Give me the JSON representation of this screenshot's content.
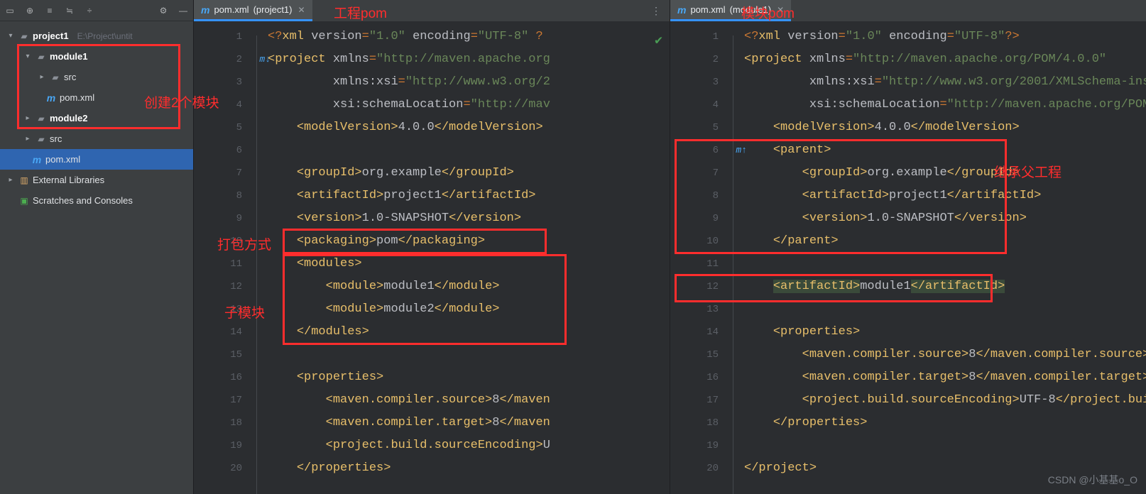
{
  "toolbar": {
    "icons": [
      "display-icon",
      "select-icon",
      "expand-icon",
      "collapse-icon",
      "divider-icon",
      "gear-icon",
      "hide-icon"
    ]
  },
  "tree": {
    "project": {
      "name": "project1",
      "path": "E:\\Project\\untit"
    },
    "module1": {
      "name": "module1"
    },
    "src1": {
      "name": "src"
    },
    "pom_m1": {
      "name": "pom.xml"
    },
    "module2": {
      "name": "module2"
    },
    "src_p": {
      "name": "src"
    },
    "pom_p": {
      "name": "pom.xml"
    },
    "ext": {
      "name": "External Libraries"
    },
    "scr": {
      "name": "Scratches and Consoles"
    }
  },
  "tabs": {
    "left": {
      "file": "pom.xml",
      "context": "(project1)"
    },
    "right": {
      "file": "pom.xml",
      "context": "(module1)"
    }
  },
  "annotations": {
    "proj_pom": "工程pom",
    "mod_pom": "模块pom",
    "create2mod": "创建2个模块",
    "packaging": "打包方式",
    "submodule": "子模块",
    "inherit": "继承父工程"
  },
  "watermark": "CSDN @小基基o_O",
  "code": {
    "left": [
      {
        "n": 1,
        "ind": 0,
        "tokens": [
          {
            "t": "op",
            "v": "<?"
          },
          {
            "t": "tag",
            "v": "xml "
          },
          {
            "t": "attr",
            "v": "version"
          },
          {
            "t": "op",
            "v": "="
          },
          {
            "t": "val",
            "v": "\"1.0\""
          },
          {
            "t": "txt",
            "v": " "
          },
          {
            "t": "attr",
            "v": "encoding"
          },
          {
            "t": "op",
            "v": "="
          },
          {
            "t": "val",
            "v": "\"UTF-8\""
          },
          {
            "t": "txt",
            "v": " "
          },
          {
            "t": "op",
            "v": "?"
          }
        ]
      },
      {
        "n": 2,
        "gmark": "m↓",
        "ind": 0,
        "tokens": [
          {
            "t": "tag",
            "v": "<project "
          },
          {
            "t": "attr",
            "v": "xmlns"
          },
          {
            "t": "op",
            "v": "="
          },
          {
            "t": "val",
            "v": "\"http://maven.apache.org"
          }
        ]
      },
      {
        "n": 3,
        "ind": 9,
        "tokens": [
          {
            "t": "attr",
            "v": "xmlns:xsi"
          },
          {
            "t": "op",
            "v": "="
          },
          {
            "t": "val",
            "v": "\"http://www.w3.org/2"
          }
        ]
      },
      {
        "n": 4,
        "ind": 9,
        "tokens": [
          {
            "t": "attr",
            "v": "xsi"
          },
          {
            "t": "txt",
            "v": ":"
          },
          {
            "t": "attr",
            "v": "schemaLocation"
          },
          {
            "t": "op",
            "v": "="
          },
          {
            "t": "val",
            "v": "\"http://mav"
          }
        ]
      },
      {
        "n": 5,
        "ind": 4,
        "tokens": [
          {
            "t": "tag",
            "v": "<modelVersion>"
          },
          {
            "t": "txt",
            "v": "4.0.0"
          },
          {
            "t": "tag",
            "v": "</modelVersion>"
          }
        ]
      },
      {
        "n": 6,
        "ind": 0,
        "tokens": []
      },
      {
        "n": 7,
        "ind": 4,
        "tokens": [
          {
            "t": "tag",
            "v": "<groupId>"
          },
          {
            "t": "txt",
            "v": "org.example"
          },
          {
            "t": "tag",
            "v": "</groupId>"
          }
        ]
      },
      {
        "n": 8,
        "ind": 4,
        "tokens": [
          {
            "t": "tag",
            "v": "<artifactId>"
          },
          {
            "t": "txt",
            "v": "project1"
          },
          {
            "t": "tag",
            "v": "</artifactId>"
          }
        ]
      },
      {
        "n": 9,
        "ind": 4,
        "tokens": [
          {
            "t": "tag",
            "v": "<version>"
          },
          {
            "t": "txt",
            "v": "1.0-SNAPSHOT"
          },
          {
            "t": "tag",
            "v": "</version>"
          }
        ]
      },
      {
        "n": 10,
        "ind": 4,
        "tokens": [
          {
            "t": "tag",
            "v": "<packaging>"
          },
          {
            "t": "txt",
            "v": "pom"
          },
          {
            "t": "tag",
            "v": "</packaging>"
          }
        ]
      },
      {
        "n": 11,
        "ind": 4,
        "tokens": [
          {
            "t": "tag",
            "v": "<modules>"
          }
        ]
      },
      {
        "n": 12,
        "ind": 8,
        "tokens": [
          {
            "t": "tag",
            "v": "<module>"
          },
          {
            "t": "txt",
            "v": "module1"
          },
          {
            "t": "tag",
            "v": "</module>"
          }
        ]
      },
      {
        "n": 13,
        "ind": 8,
        "tokens": [
          {
            "t": "tag",
            "v": "<module>"
          },
          {
            "t": "txt",
            "v": "module2"
          },
          {
            "t": "tag",
            "v": "</module>"
          }
        ]
      },
      {
        "n": 14,
        "ind": 4,
        "tokens": [
          {
            "t": "tag",
            "v": "</modules>"
          }
        ]
      },
      {
        "n": 15,
        "ind": 0,
        "tokens": []
      },
      {
        "n": 16,
        "ind": 4,
        "tokens": [
          {
            "t": "tag",
            "v": "<properties>"
          }
        ]
      },
      {
        "n": 17,
        "ind": 8,
        "tokens": [
          {
            "t": "tag",
            "v": "<maven.compiler.source>"
          },
          {
            "t": "txt",
            "v": "8"
          },
          {
            "t": "tag",
            "v": "</maven"
          }
        ]
      },
      {
        "n": 18,
        "ind": 8,
        "tokens": [
          {
            "t": "tag",
            "v": "<maven.compiler.target>"
          },
          {
            "t": "txt",
            "v": "8"
          },
          {
            "t": "tag",
            "v": "</maven"
          }
        ]
      },
      {
        "n": 19,
        "ind": 8,
        "tokens": [
          {
            "t": "tag",
            "v": "<project.build.sourceEncoding>"
          },
          {
            "t": "txt",
            "v": "U"
          }
        ]
      },
      {
        "n": 20,
        "ind": 4,
        "tokens": [
          {
            "t": "tag",
            "v": "</properties>"
          }
        ]
      }
    ],
    "right": [
      {
        "n": 1,
        "ind": 0,
        "tokens": [
          {
            "t": "op",
            "v": "<?"
          },
          {
            "t": "tag",
            "v": "xml "
          },
          {
            "t": "attr",
            "v": "version"
          },
          {
            "t": "op",
            "v": "="
          },
          {
            "t": "val",
            "v": "\"1.0\""
          },
          {
            "t": "txt",
            "v": " "
          },
          {
            "t": "attr",
            "v": "encoding"
          },
          {
            "t": "op",
            "v": "="
          },
          {
            "t": "val",
            "v": "\"UTF-8\""
          },
          {
            "t": "op",
            "v": "?>"
          }
        ]
      },
      {
        "n": 2,
        "ind": 0,
        "tokens": [
          {
            "t": "tag",
            "v": "<project "
          },
          {
            "t": "attr",
            "v": "xmlns"
          },
          {
            "t": "op",
            "v": "="
          },
          {
            "t": "val",
            "v": "\"http://maven.apache.org/POM/4.0.0\""
          }
        ]
      },
      {
        "n": 3,
        "ind": 9,
        "tokens": [
          {
            "t": "attr",
            "v": "xmlns:xsi"
          },
          {
            "t": "op",
            "v": "="
          },
          {
            "t": "val",
            "v": "\"http://www.w3.org/2001/XMLSchema-ins"
          }
        ]
      },
      {
        "n": 4,
        "ind": 9,
        "tokens": [
          {
            "t": "attr",
            "v": "xsi"
          },
          {
            "t": "txt",
            "v": ":"
          },
          {
            "t": "attr",
            "v": "schemaLocation"
          },
          {
            "t": "op",
            "v": "="
          },
          {
            "t": "val",
            "v": "\"http://maven.apache.org/POM"
          }
        ]
      },
      {
        "n": 5,
        "ind": 4,
        "tokens": [
          {
            "t": "tag",
            "v": "<modelVersion>"
          },
          {
            "t": "txt",
            "v": "4.0.0"
          },
          {
            "t": "tag",
            "v": "</modelVersion>"
          }
        ]
      },
      {
        "n": 6,
        "gmark": "m↑",
        "ind": 4,
        "tokens": [
          {
            "t": "tag",
            "v": "<parent>"
          }
        ]
      },
      {
        "n": 7,
        "ind": 8,
        "tokens": [
          {
            "t": "tag",
            "v": "<groupId>"
          },
          {
            "t": "txt",
            "v": "org.example"
          },
          {
            "t": "tag",
            "v": "</groupId>"
          }
        ]
      },
      {
        "n": 8,
        "ind": 8,
        "tokens": [
          {
            "t": "tag",
            "v": "<artifactId>"
          },
          {
            "t": "txt",
            "v": "project1"
          },
          {
            "t": "tag",
            "v": "</artifactId>"
          }
        ]
      },
      {
        "n": 9,
        "ind": 8,
        "tokens": [
          {
            "t": "tag",
            "v": "<version>"
          },
          {
            "t": "txt",
            "v": "1.0-SNAPSHOT"
          },
          {
            "t": "tag",
            "v": "</version>"
          }
        ]
      },
      {
        "n": 10,
        "ind": 4,
        "tokens": [
          {
            "t": "tag",
            "v": "</parent>"
          }
        ]
      },
      {
        "n": 11,
        "ind": 0,
        "tokens": []
      },
      {
        "n": 12,
        "ind": 4,
        "hl": true,
        "tokens": [
          {
            "t": "tag",
            "v": "<artifactId>"
          },
          {
            "t": "txt",
            "v": "module1"
          },
          {
            "t": "tag",
            "v": "</artifactId>"
          }
        ]
      },
      {
        "n": 13,
        "ind": 0,
        "tokens": []
      },
      {
        "n": 14,
        "ind": 4,
        "tokens": [
          {
            "t": "tag",
            "v": "<properties>"
          }
        ]
      },
      {
        "n": 15,
        "ind": 8,
        "tokens": [
          {
            "t": "tag",
            "v": "<maven.compiler.source>"
          },
          {
            "t": "txt",
            "v": "8"
          },
          {
            "t": "tag",
            "v": "</maven.compiler.source>"
          }
        ]
      },
      {
        "n": 16,
        "ind": 8,
        "tokens": [
          {
            "t": "tag",
            "v": "<maven.compiler.target>"
          },
          {
            "t": "txt",
            "v": "8"
          },
          {
            "t": "tag",
            "v": "</maven.compiler.target>"
          }
        ]
      },
      {
        "n": 17,
        "ind": 8,
        "tokens": [
          {
            "t": "tag",
            "v": "<project.build.sourceEncoding>"
          },
          {
            "t": "txt",
            "v": "UTF-8"
          },
          {
            "t": "tag",
            "v": "</project.bui"
          }
        ]
      },
      {
        "n": 18,
        "ind": 4,
        "tokens": [
          {
            "t": "tag",
            "v": "</properties>"
          }
        ]
      },
      {
        "n": 19,
        "ind": 0,
        "tokens": []
      },
      {
        "n": 20,
        "ind": 0,
        "tokens": [
          {
            "t": "tag",
            "v": "</project>"
          }
        ]
      }
    ]
  }
}
